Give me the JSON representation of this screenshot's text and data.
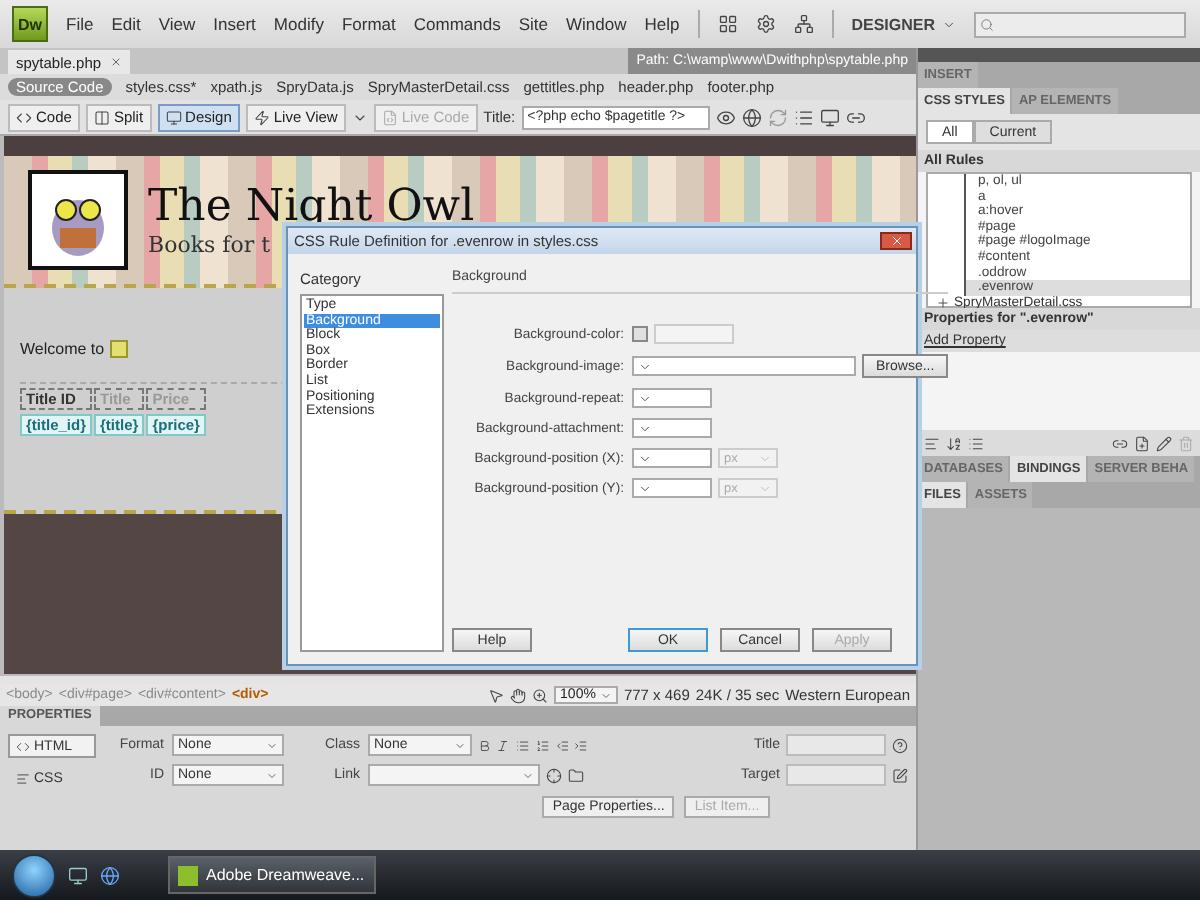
{
  "app": {
    "logo": "Dw",
    "menus": [
      "File",
      "Edit",
      "View",
      "Insert",
      "Modify",
      "Format",
      "Commands",
      "Site",
      "Window",
      "Help"
    ],
    "workspace": "DESIGNER"
  },
  "document": {
    "tab": "spytable.php",
    "path": "Path: C:\\wamp\\www\\Dwithphp\\spytable.php",
    "related_files": [
      {
        "label": "Source Code",
        "selected": true
      },
      {
        "label": "styles.css*",
        "selected": false
      },
      {
        "label": "xpath.js",
        "selected": false
      },
      {
        "label": "SpryData.js",
        "selected": false
      },
      {
        "label": "SpryMasterDetail.css",
        "selected": false
      },
      {
        "label": "gettitles.php",
        "selected": false
      },
      {
        "label": "header.php",
        "selected": false
      },
      {
        "label": "footer.php",
        "selected": false
      }
    ],
    "views": [
      {
        "label": "Code",
        "selected": false
      },
      {
        "label": "Split",
        "selected": false
      },
      {
        "label": "Design",
        "selected": true
      }
    ],
    "live_view": "Live View",
    "live_code": "Live Code",
    "title_label": "Title:",
    "title_value": "<?php echo $pagetitle ?>"
  },
  "page": {
    "banner_title": "The Night Owl",
    "banner_subtitle": "Books for t",
    "welcome": "Welcome to",
    "table_header": [
      "Title ID",
      "Title",
      "Price"
    ],
    "table_row": [
      "{title_id}",
      "{title}",
      "{price}"
    ]
  },
  "status": {
    "tags": [
      {
        "label": "<body>",
        "selected": false
      },
      {
        "label": "<div#page>",
        "selected": false
      },
      {
        "label": "<div#content>",
        "selected": false
      },
      {
        "label": "<div>",
        "selected": true
      }
    ],
    "zoom": "100%",
    "size": "777 x 469",
    "download": "24K / 35 sec",
    "encoding": "Western European"
  },
  "properties": {
    "title": "PROPERTIES",
    "modes": [
      {
        "label": "HTML",
        "selected": true
      },
      {
        "label": "CSS",
        "selected": false
      }
    ],
    "format_label": "Format",
    "format_value": "None",
    "id_label": "ID",
    "id_value": "None",
    "class_label": "Class",
    "class_value": "None",
    "link_label": "Link",
    "title_label": "Title",
    "target_label": "Target",
    "buttons": [
      {
        "label": "Page Properties...",
        "disabled": false
      },
      {
        "label": "List Item...",
        "disabled": true
      }
    ]
  },
  "dialog": {
    "title": "CSS Rule Definition for .evenrow in styles.css",
    "category_label": "Category",
    "categories": [
      {
        "label": "Type",
        "selected": false
      },
      {
        "label": "Background",
        "selected": true
      },
      {
        "label": "Block",
        "selected": false
      },
      {
        "label": "Box",
        "selected": false
      },
      {
        "label": "Border",
        "selected": false
      },
      {
        "label": "List",
        "selected": false
      },
      {
        "label": "Positioning",
        "selected": false
      },
      {
        "label": "Extensions",
        "selected": false
      }
    ],
    "section": "Background",
    "fields": [
      {
        "label": "Background-color:",
        "kind": "color"
      },
      {
        "label": "Background-image:",
        "kind": "file",
        "button": "Browse..."
      },
      {
        "label": "Background-repeat:",
        "kind": "select"
      },
      {
        "label": "Background-attachment:",
        "kind": "select"
      },
      {
        "label": "Background-position (X):",
        "kind": "unit",
        "unit": "px"
      },
      {
        "label": "Background-position (Y):",
        "kind": "unit",
        "unit": "px"
      }
    ],
    "buttons": [
      {
        "label": "Help",
        "kind": "help",
        "disabled": false
      },
      {
        "label": "OK",
        "kind": "default",
        "disabled": false
      },
      {
        "label": "Cancel",
        "kind": "normal",
        "disabled": false
      },
      {
        "label": "Apply",
        "kind": "normal",
        "disabled": true
      }
    ]
  },
  "panel": {
    "insert": "INSERT",
    "tabs": [
      {
        "label": "CSS STYLES",
        "selected": true
      },
      {
        "label": "AP ELEMENTS",
        "selected": false
      }
    ],
    "toggles": [
      {
        "label": "All",
        "selected": true
      },
      {
        "label": "Current",
        "selected": false
      }
    ],
    "rules_heading": "All Rules",
    "rules": [
      {
        "label": "p, ol, ul",
        "selected": false
      },
      {
        "label": "a",
        "selected": false
      },
      {
        "label": "a:hover",
        "selected": false
      },
      {
        "label": "#page",
        "selected": false
      },
      {
        "label": "#page #logoImage",
        "selected": false
      },
      {
        "label": "#content",
        "selected": false
      },
      {
        "label": ".oddrow",
        "selected": false
      },
      {
        "label": ".evenrow",
        "selected": true
      }
    ],
    "sheets": [
      {
        "label": "SpryMasterDetail.css",
        "expanded": false
      }
    ],
    "properties_for": "Properties for \".evenrow\"",
    "add_property": "Add Property",
    "bottom_tabs": [
      {
        "label": "DATABASES",
        "selected": false
      },
      {
        "label": "BINDINGS",
        "selected": true
      },
      {
        "label": "SERVER BEHA",
        "selected": false
      }
    ],
    "file_tabs": [
      {
        "label": "FILES",
        "selected": true
      },
      {
        "label": "ASSETS",
        "selected": false
      }
    ]
  },
  "taskbar": {
    "task": "Adobe Dreamweave..."
  }
}
